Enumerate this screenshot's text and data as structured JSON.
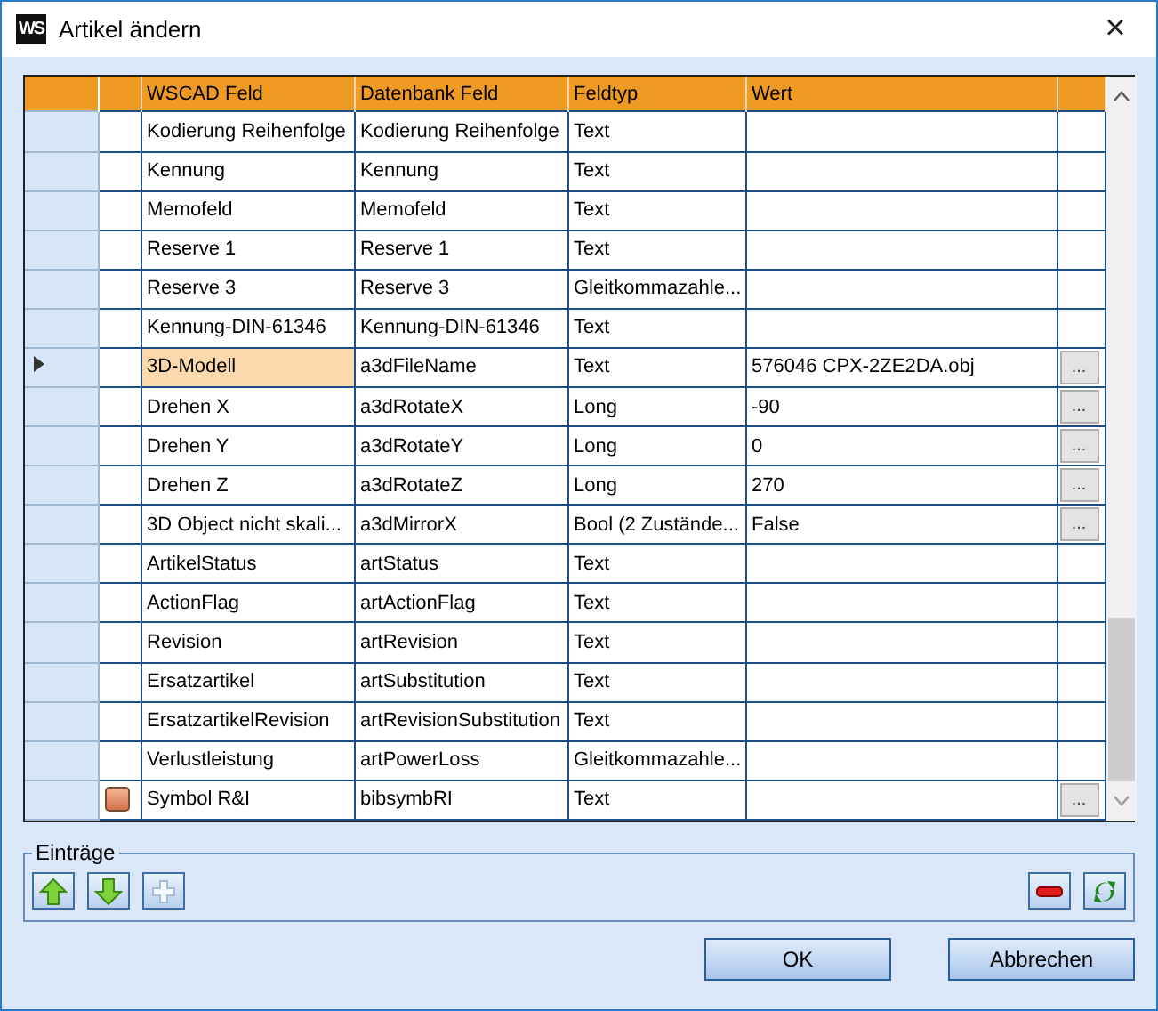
{
  "window": {
    "title": "Artikel ändern",
    "app_badge": "WS",
    "close": "×"
  },
  "table": {
    "columns": [
      "WSCAD Feld",
      "Datenbank Feld",
      "Feldtyp",
      "Wert"
    ],
    "rows": [
      {
        "wscad": "Kodierung Reihenfolge",
        "db": "Kodierung Reihenfolge",
        "type": "Text",
        "value": "",
        "button": "",
        "selected": false,
        "symbol": false
      },
      {
        "wscad": "Kennung",
        "db": "Kennung",
        "type": "Text",
        "value": "",
        "button": "",
        "selected": false,
        "symbol": false
      },
      {
        "wscad": "Memofeld",
        "db": "Memofeld",
        "type": "Text",
        "value": "",
        "button": "",
        "selected": false,
        "symbol": false
      },
      {
        "wscad": "Reserve 1",
        "db": "Reserve 1",
        "type": "Text",
        "value": "",
        "button": "",
        "selected": false,
        "symbol": false
      },
      {
        "wscad": "Reserve 3",
        "db": "Reserve 3",
        "type": "Gleitkommazahle...",
        "value": "",
        "button": "",
        "selected": false,
        "symbol": false
      },
      {
        "wscad": "Kennung-DIN-61346",
        "db": "Kennung-DIN-61346",
        "type": "Text",
        "value": "",
        "button": "",
        "selected": false,
        "symbol": false
      },
      {
        "wscad": "3D-Modell",
        "db": "a3dFileName",
        "type": "Text",
        "value": "576046 CPX-2ZE2DA.obj",
        "button": "...",
        "selected": true,
        "symbol": false
      },
      {
        "wscad": "Drehen X",
        "db": "a3dRotateX",
        "type": "Long",
        "value": "-90",
        "button": "...",
        "selected": false,
        "symbol": false
      },
      {
        "wscad": "Drehen Y",
        "db": "a3dRotateY",
        "type": "Long",
        "value": "0",
        "button": "...",
        "selected": false,
        "symbol": false
      },
      {
        "wscad": "Drehen Z",
        "db": "a3dRotateZ",
        "type": "Long",
        "value": "270",
        "button": "...",
        "selected": false,
        "symbol": false
      },
      {
        "wscad": "3D Object nicht skali...",
        "db": "a3dMirrorX",
        "type": "Bool (2 Zustände...",
        "value": "False",
        "button": "...",
        "selected": false,
        "symbol": false
      },
      {
        "wscad": "ArtikelStatus",
        "db": "artStatus",
        "type": "Text",
        "value": "",
        "button": "",
        "selected": false,
        "symbol": false
      },
      {
        "wscad": "ActionFlag",
        "db": "artActionFlag",
        "type": "Text",
        "value": "",
        "button": "",
        "selected": false,
        "symbol": false
      },
      {
        "wscad": "Revision",
        "db": "artRevision",
        "type": "Text",
        "value": "",
        "button": "",
        "selected": false,
        "symbol": false
      },
      {
        "wscad": "Ersatzartikel",
        "db": "artSubstitution",
        "type": "Text",
        "value": "",
        "button": "",
        "selected": false,
        "symbol": false
      },
      {
        "wscad": "ErsatzartikelRevision",
        "db": "artRevisionSubstitution",
        "type": "Text",
        "value": "",
        "button": "",
        "selected": false,
        "symbol": false
      },
      {
        "wscad": "Verlustleistung",
        "db": "artPowerLoss",
        "type": "Gleitkommazahle...",
        "value": "",
        "button": "",
        "selected": false,
        "symbol": false
      },
      {
        "wscad": "Symbol R&I",
        "db": "bibsymbRI",
        "type": "Text",
        "value": "",
        "button": "...",
        "selected": false,
        "symbol": true
      }
    ]
  },
  "entries": {
    "title": "Einträge",
    "tools": [
      {
        "kind": "up",
        "disabled": false
      },
      {
        "kind": "down",
        "disabled": false
      },
      {
        "kind": "add",
        "disabled": true
      },
      {
        "kind": "remove",
        "disabled": false
      },
      {
        "kind": "refresh",
        "disabled": false
      }
    ]
  },
  "buttons": [
    "OK",
    "Abbrechen"
  ]
}
